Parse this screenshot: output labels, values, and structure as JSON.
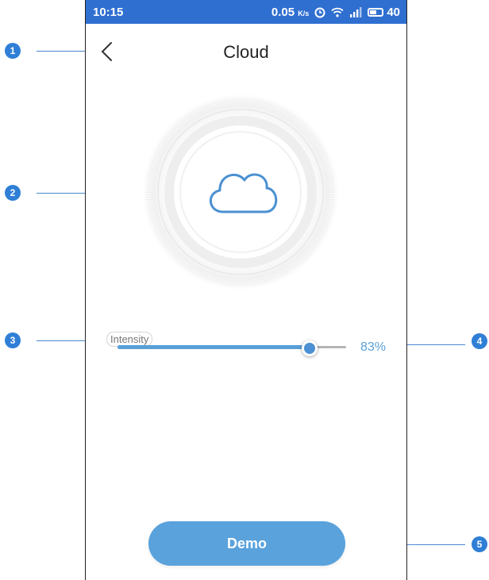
{
  "status_bar": {
    "time": "10:15",
    "speed_value": "0.05",
    "speed_unit": "K/s",
    "battery": "40"
  },
  "header": {
    "title": "Cloud"
  },
  "dial": {
    "icon": "cloud-icon"
  },
  "intensity": {
    "label": "Intensity",
    "value_text": "83%",
    "fraction": 0.83
  },
  "demo_button": {
    "label": "Demo"
  },
  "callouts": [
    "1",
    "2",
    "3",
    "4",
    "5"
  ],
  "colors": {
    "status_bar": "#2f6fd0",
    "accent": "#5a9fd6",
    "button": "#5aa2dc",
    "callout": "#2f7fd6"
  }
}
